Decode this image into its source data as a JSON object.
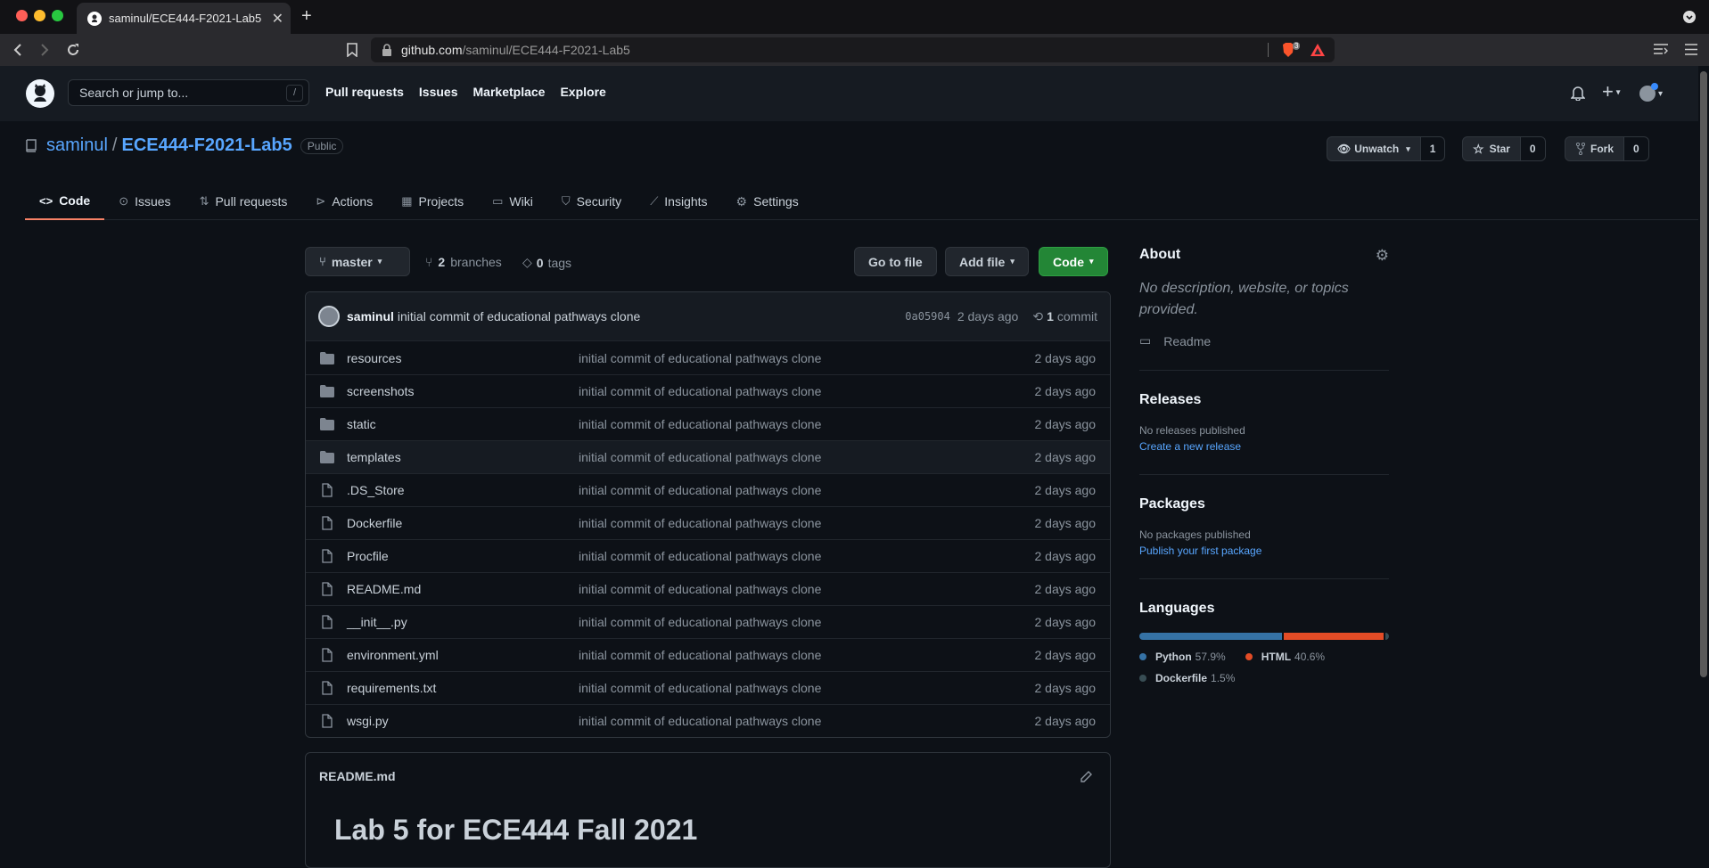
{
  "browser": {
    "tab_title": "saminul/ECE444-F2021-Lab5",
    "url_host": "github.com",
    "url_path": "/saminul/ECE444-F2021-Lab5",
    "shield_count": "3"
  },
  "header": {
    "search_placeholder": "Search or jump to...",
    "search_key": "/",
    "nav": [
      "Pull requests",
      "Issues",
      "Marketplace",
      "Explore"
    ]
  },
  "repo": {
    "owner": "saminul",
    "separator": "/",
    "name": "ECE444-F2021-Lab5",
    "visibility": "Public",
    "watch_label": "Unwatch",
    "watch_count": "1",
    "star_label": "Star",
    "star_count": "0",
    "fork_label": "Fork",
    "fork_count": "0"
  },
  "tabs": [
    {
      "label": "Code",
      "icon": "code-icon"
    },
    {
      "label": "Issues",
      "icon": "issue-icon"
    },
    {
      "label": "Pull requests",
      "icon": "pull-request-icon"
    },
    {
      "label": "Actions",
      "icon": "play-icon"
    },
    {
      "label": "Projects",
      "icon": "project-icon"
    },
    {
      "label": "Wiki",
      "icon": "book-icon"
    },
    {
      "label": "Security",
      "icon": "shield-icon"
    },
    {
      "label": "Insights",
      "icon": "graph-icon"
    },
    {
      "label": "Settings",
      "icon": "gear-icon"
    }
  ],
  "branchbar": {
    "branch": "master",
    "branches_count": "2",
    "branches_label": "branches",
    "tags_count": "0",
    "tags_label": "tags",
    "goto_file": "Go to file",
    "add_file": "Add file",
    "code": "Code"
  },
  "latest_commit": {
    "author": "saminul",
    "message": "initial commit of educational pathways clone",
    "sha": "0a05904",
    "age": "2 days ago",
    "count": "1",
    "count_label": "commit"
  },
  "files": [
    {
      "name": "resources",
      "type": "dir",
      "message": "initial commit of educational pathways clone",
      "age": "2 days ago"
    },
    {
      "name": "screenshots",
      "type": "dir",
      "message": "initial commit of educational pathways clone",
      "age": "2 days ago"
    },
    {
      "name": "static",
      "type": "dir",
      "message": "initial commit of educational pathways clone",
      "age": "2 days ago"
    },
    {
      "name": "templates",
      "type": "dir",
      "message": "initial commit of educational pathways clone",
      "age": "2 days ago"
    },
    {
      "name": ".DS_Store",
      "type": "file",
      "message": "initial commit of educational pathways clone",
      "age": "2 days ago"
    },
    {
      "name": "Dockerfile",
      "type": "file",
      "message": "initial commit of educational pathways clone",
      "age": "2 days ago"
    },
    {
      "name": "Procfile",
      "type": "file",
      "message": "initial commit of educational pathways clone",
      "age": "2 days ago"
    },
    {
      "name": "README.md",
      "type": "file",
      "message": "initial commit of educational pathways clone",
      "age": "2 days ago"
    },
    {
      "name": "__init__.py",
      "type": "file",
      "message": "initial commit of educational pathways clone",
      "age": "2 days ago"
    },
    {
      "name": "environment.yml",
      "type": "file",
      "message": "initial commit of educational pathways clone",
      "age": "2 days ago"
    },
    {
      "name": "requirements.txt",
      "type": "file",
      "message": "initial commit of educational pathways clone",
      "age": "2 days ago"
    },
    {
      "name": "wsgi.py",
      "type": "file",
      "message": "initial commit of educational pathways clone",
      "age": "2 days ago"
    }
  ],
  "readme": {
    "filename": "README.md",
    "heading": "Lab 5 for ECE444 Fall 2021"
  },
  "about": {
    "title": "About",
    "description": "No description, website, or topics provided.",
    "readme_link": "Readme"
  },
  "releases": {
    "title": "Releases",
    "none": "No releases published",
    "create": "Create a new release"
  },
  "packages": {
    "title": "Packages",
    "none": "No packages published",
    "publish": "Publish your first package"
  },
  "languages": {
    "title": "Languages",
    "items": [
      {
        "name": "Python",
        "percent": "57.9%",
        "value": 57.9,
        "color": "#3572A5"
      },
      {
        "name": "HTML",
        "percent": "40.6%",
        "value": 40.6,
        "color": "#e34c26"
      },
      {
        "name": "Dockerfile",
        "percent": "1.5%",
        "value": 1.5,
        "color": "#384d54"
      }
    ]
  }
}
